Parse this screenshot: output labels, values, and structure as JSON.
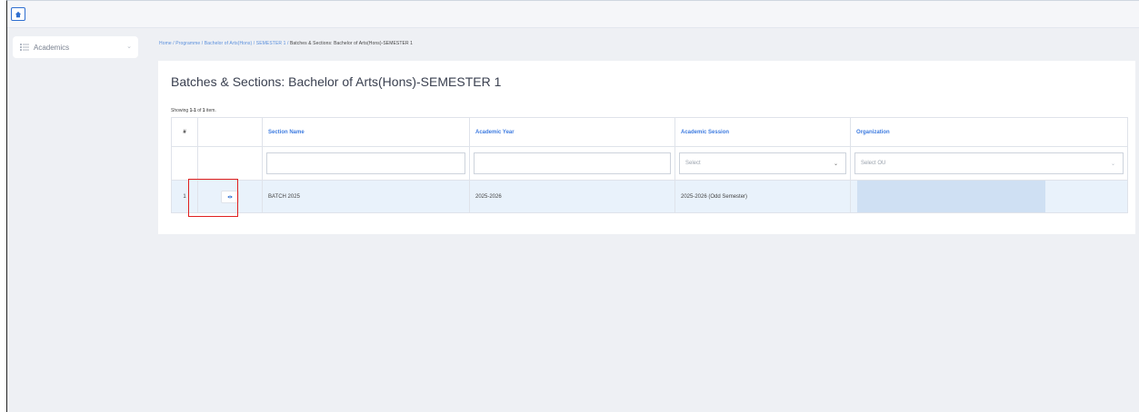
{
  "topbar": {
    "home_icon": "home-icon"
  },
  "sidebar": {
    "items": [
      {
        "label": "Academics",
        "icon": "grid-list-icon"
      }
    ]
  },
  "breadcrumb": {
    "items": [
      "Home",
      "Programme",
      "Bachelor of Arts(Hons)",
      "SEMESTER 1"
    ],
    "separator": "/",
    "current": "Batches & Sections: Bachelor of Arts(Hons)-SEMESTER 1"
  },
  "page": {
    "title": "Batches & Sections: Bachelor of Arts(Hons)-SEMESTER 1",
    "summary_prefix": "Showing",
    "summary_range": "1-1",
    "summary_of": "of",
    "summary_total": "1",
    "summary_suffix": "item."
  },
  "table": {
    "headers": [
      "#",
      "",
      "Section Name",
      "Academic Year",
      "Academic Session",
      "Organization"
    ],
    "filters": {
      "section_name": "",
      "academic_year": "",
      "academic_session_placeholder": "Select",
      "organization_placeholder": "Select OU"
    },
    "rows": [
      {
        "num": "1",
        "action_icon": "eye-icon",
        "section_name": "BATCH 2025",
        "academic_year": "2025-2026",
        "academic_session": "2025-2026 (Odd Semester)",
        "organization": ""
      }
    ]
  },
  "colors": {
    "accent": "#3d7be0",
    "highlight": "#e02020",
    "row_bg": "#e9f2fb",
    "org_cell_bg": "#cfe0f3"
  }
}
